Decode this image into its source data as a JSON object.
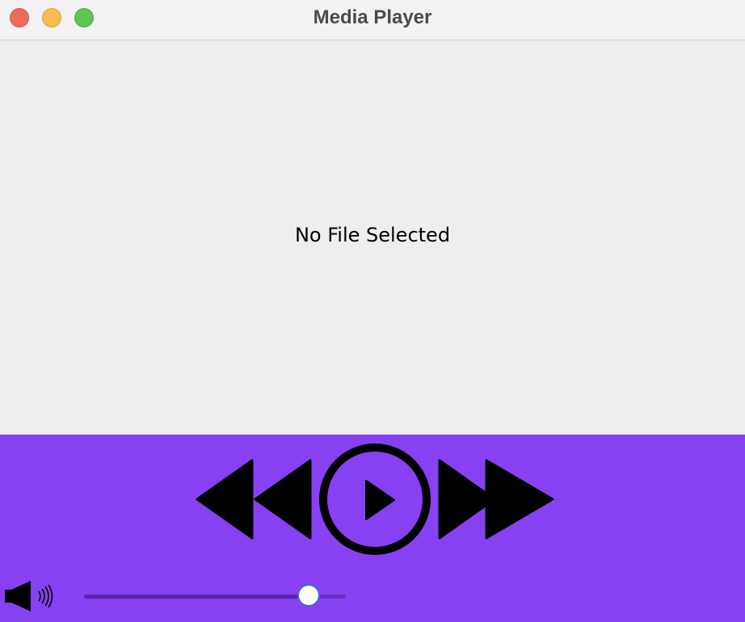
{
  "window": {
    "title": "Media Player"
  },
  "viewer": {
    "message": "No File Selected"
  },
  "controls": {
    "rewind_icon": "rewind-icon",
    "play_icon": "play-icon",
    "fast_forward_icon": "fast-forward-icon",
    "volume_icon": "speaker-icon",
    "volume_level": 0.86
  },
  "colors": {
    "controls_background": "#8741f2",
    "viewer_background": "#eeeeee",
    "close": "#ed6a5e",
    "minimize": "#f5bf4f",
    "maximize": "#61c554"
  }
}
